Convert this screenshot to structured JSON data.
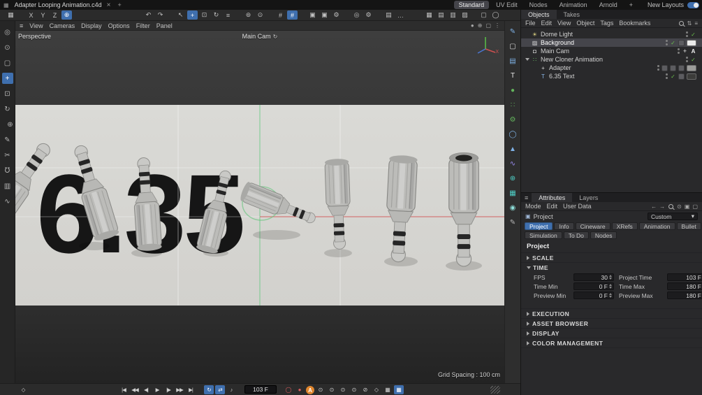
{
  "titlebar": {
    "window_icon": "▦",
    "title": "Adapter Looping Animation.c4d",
    "close_glyph": "×",
    "new_tab_glyph": "+",
    "layout_tabs": [
      {
        "name": "layout-tab-standard",
        "label": "Standard",
        "active": true
      },
      {
        "name": "layout-tab-uvedit",
        "label": "UV Edit"
      },
      {
        "name": "layout-tab-nodes",
        "label": "Nodes"
      },
      {
        "name": "layout-tab-animation",
        "label": "Animation"
      },
      {
        "name": "layout-tab-arnold",
        "label": "Arnold"
      },
      {
        "name": "layout-tab-add",
        "label": "+"
      }
    ],
    "new_layouts_label": "New Layouts"
  },
  "toolbar": {
    "icons": [
      {
        "name": "workplane-icon",
        "glyph": "▦"
      },
      {
        "name": "axis-x-button",
        "glyph": "X",
        "gap": 12
      },
      {
        "name": "axis-y-button",
        "glyph": "Y"
      },
      {
        "name": "axis-z-button",
        "glyph": "Z"
      },
      {
        "name": "coord-system-button",
        "glyph": "⊕",
        "active": true
      },
      {
        "name": "undo-button",
        "glyph": "↶",
        "gap": 100
      },
      {
        "name": "redo-button",
        "glyph": "↷"
      },
      {
        "name": "live-selection-button",
        "glyph": "↖",
        "gap": 12
      },
      {
        "name": "move-tool-button",
        "glyph": "+",
        "active": true
      },
      {
        "name": "scale-tool-button",
        "glyph": "⊡"
      },
      {
        "name": "rotate-tool-button",
        "glyph": "↻"
      },
      {
        "name": "tool-history-button",
        "glyph": "≡"
      },
      {
        "name": "simulate-button",
        "glyph": "⊚",
        "gap": 12
      },
      {
        "name": "pin-button",
        "glyph": "⊙"
      },
      {
        "name": "grid-snap-button",
        "glyph": "#",
        "gap": 12
      },
      {
        "name": "quantize-button",
        "glyph": "#",
        "active": true
      },
      {
        "name": "render-view-button",
        "glyph": "▣",
        "gap": 12
      },
      {
        "name": "render-picture-viewer-button",
        "glyph": "▣"
      },
      {
        "name": "render-settings-button",
        "glyph": "⚙"
      },
      {
        "name": "solo-button",
        "glyph": "◎",
        "gap": 12
      },
      {
        "name": "project-settings-button",
        "glyph": "⚙"
      },
      {
        "name": "content-browser-button",
        "glyph": "▤",
        "gap": 12
      },
      {
        "name": "more-tools-button",
        "glyph": "…"
      }
    ],
    "right_icons": [
      {
        "name": "layout-split-1-button",
        "glyph": "▦"
      },
      {
        "name": "layout-split-2-button",
        "glyph": "▤"
      },
      {
        "name": "layout-split-3-button",
        "glyph": "▥"
      },
      {
        "name": "layout-split-4-button",
        "glyph": "▨"
      },
      {
        "name": "panel-toggle-button",
        "glyph": "▢",
        "gap": 10
      },
      {
        "name": "capsule-button",
        "glyph": "◯"
      }
    ]
  },
  "left_strip": {
    "icons": [
      {
        "name": "zoom-tool-icon",
        "glyph": "◎"
      },
      {
        "name": "selection-tool-icon",
        "glyph": "⊙"
      },
      {
        "name": "lasso-tool-icon",
        "glyph": "▢"
      },
      {
        "name": "move-tool-icon",
        "glyph": "+",
        "active": true
      },
      {
        "name": "scale-tool-icon",
        "glyph": "⊡"
      },
      {
        "name": "rotate-tool-icon",
        "glyph": "↻"
      },
      {
        "name": "axis-lock-icon",
        "glyph": "⊕",
        "gap": 8
      },
      {
        "name": "brush-tool-icon",
        "glyph": "✎"
      },
      {
        "name": "knife-tool-icon",
        "glyph": "✂"
      },
      {
        "name": "magnet-tool-icon",
        "glyph": "℧"
      },
      {
        "name": "mirror-tool-icon",
        "glyph": "▥"
      },
      {
        "name": "smooth-tool-icon",
        "glyph": "∿"
      }
    ]
  },
  "viewport": {
    "menu_icon": "≡",
    "menu": [
      "View",
      "Cameras",
      "Display",
      "Options",
      "Filter",
      "Panel"
    ],
    "corner_icons": [
      {
        "name": "hud-icon",
        "glyph": "●"
      },
      {
        "name": "gizmo-toggle-icon",
        "glyph": "⊕"
      },
      {
        "name": "viewport-layout-icon",
        "glyph": "▢"
      },
      {
        "name": "viewport-options-icon",
        "glyph": "⋮"
      }
    ],
    "view_label": "Perspective",
    "camera_label": "Main Cam",
    "camera_swap_glyph": "↻",
    "big_text": "6.35",
    "axis_x_label": "X",
    "grid_spacing_label": "Grid Spacing : 100 cm"
  },
  "shelf": {
    "icons": [
      {
        "name": "spline-pen-icon",
        "glyph": "✎",
        "color": "#7fb2e6"
      },
      {
        "name": "cube-primitive-icon",
        "glyph": "▢",
        "color": "#d8d8d8"
      },
      {
        "name": "extrude-icon",
        "glyph": "▤",
        "color": "#7fb2e6"
      },
      {
        "name": "text-object-icon",
        "glyph": "T",
        "color": "#e8e8e8"
      },
      {
        "name": "sphere-primitive-icon",
        "glyph": "●",
        "color": "#63b35c"
      },
      {
        "name": "cloner-icon",
        "glyph": "∷",
        "color": "#63b35c"
      },
      {
        "name": "dynamics-icon",
        "glyph": "⚙",
        "color": "#63b35c"
      },
      {
        "name": "field-icon",
        "glyph": "◯",
        "color": "#7fb2e6"
      },
      {
        "name": "volume-icon",
        "glyph": "▲",
        "color": "#7fb2e6"
      },
      {
        "name": "deformer-icon",
        "glyph": "∿",
        "color": "#9a8cf0"
      },
      {
        "name": "environment-icon",
        "glyph": "⊕",
        "color": "#4fd0c7"
      },
      {
        "name": "scene-nodes-icon",
        "glyph": "▦",
        "color": "#4fd0c7"
      },
      {
        "name": "material-icon",
        "glyph": "◉",
        "color": "#8eded9"
      },
      {
        "name": "annotation-icon",
        "glyph": "✎",
        "color": "#b5b5b5"
      }
    ]
  },
  "objects_panel": {
    "tabs": [
      {
        "name": "tab-objects",
        "label": "Objects",
        "active": true
      },
      {
        "name": "tab-takes",
        "label": "Takes"
      }
    ],
    "menu": [
      "File",
      "Edit",
      "View",
      "Object",
      "Tags",
      "Bookmarks"
    ],
    "menu_icons": {
      "sort": "⇅",
      "filter": "≡"
    },
    "check_glyph": "✓",
    "items": [
      {
        "label": "Dome Light",
        "icon": "☀"
      },
      {
        "label": "Background",
        "icon": "▨"
      },
      {
        "label": "Main Cam",
        "icon": "◘",
        "cross_glyph": "+",
        "badge": "A"
      },
      {
        "label": "New Cloner Animation",
        "icon": "∷"
      },
      {
        "label": "Adapter",
        "icon": "+"
      },
      {
        "label": "6.35 Text",
        "icon": "T"
      }
    ]
  },
  "attributes_panel": {
    "panel_menu_icon": "≡",
    "tabs": [
      {
        "name": "tab-attributes",
        "label": "Attributes",
        "active": true
      },
      {
        "name": "tab-layers",
        "label": "Layers"
      }
    ],
    "menu": [
      "Mode",
      "Edit",
      "User Data"
    ],
    "menu_icons": {
      "back": "←",
      "forward": "→",
      "pin": "⊙",
      "lock": "▣",
      "float": "▢"
    },
    "object_icon": "▣",
    "object_name": "Project",
    "preset_value": "Custom",
    "dropdown_glyph": "▾",
    "tab_row1": [
      {
        "name": "attr-tab-project",
        "label": "Project",
        "active": true
      },
      {
        "name": "attr-tab-info",
        "label": "Info"
      },
      {
        "name": "attr-tab-cineware",
        "label": "Cineware"
      },
      {
        "name": "attr-tab-xrefs",
        "label": "XRefs"
      },
      {
        "name": "attr-tab-animation",
        "label": "Animation"
      },
      {
        "name": "attr-tab-bullet",
        "label": "Bullet"
      }
    ],
    "tab_row2": [
      {
        "name": "attr-tab-simulation",
        "label": "Simulation"
      },
      {
        "name": "attr-tab-todo",
        "label": "To Do"
      },
      {
        "name": "attr-tab-nodes",
        "label": "Nodes"
      }
    ],
    "title": "Project",
    "scale_section_label": "SCALE",
    "time_section_label": "TIME",
    "time_fields": [
      {
        "label": "FPS",
        "value": "30"
      },
      {
        "label": "Project Time",
        "value": "103 F"
      },
      {
        "label": "Time Min",
        "value": "0 F"
      },
      {
        "label": "Time Max",
        "value": "180 F"
      },
      {
        "label": "Preview Min",
        "value": "0 F"
      },
      {
        "label": "Preview Max",
        "value": "180 F"
      }
    ],
    "collapsed_sections": [
      "EXECUTION",
      "ASSET BROWSER",
      "DISPLAY",
      "COLOR MANAGEMENT"
    ]
  },
  "bottom_bar": {
    "keyframe_glyph": "◇",
    "transport": [
      {
        "name": "jump-start-button",
        "glyph": "|◀"
      },
      {
        "name": "prev-key-button",
        "glyph": "◀◀"
      },
      {
        "name": "prev-frame-button",
        "glyph": "◀|"
      },
      {
        "name": "play-button",
        "glyph": "▶"
      },
      {
        "name": "next-frame-button",
        "glyph": "|▶"
      },
      {
        "name": "next-key-button",
        "glyph": "▶▶"
      },
      {
        "name": "jump-end-button",
        "glyph": "▶|"
      },
      {
        "name": "loop-mode-button",
        "glyph": "↻",
        "active": true,
        "gap": 10
      },
      {
        "name": "range-mode-button",
        "glyph": "⇄",
        "active": true
      },
      {
        "name": "sound-toggle-button",
        "glyph": "♪"
      }
    ],
    "frame_value": "103 F",
    "record_icons": [
      {
        "name": "record-ring-button",
        "glyph": "◯",
        "color": "#d85c5c"
      },
      {
        "name": "record-dot-button",
        "glyph": "●",
        "color": "#d85c5c"
      },
      {
        "name": "autokey-button",
        "glyph": "A",
        "class": "autokey"
      },
      {
        "name": "record-position-button",
        "glyph": "⊙"
      },
      {
        "name": "record-scale-button",
        "glyph": "⊙"
      },
      {
        "name": "record-rotation-button",
        "glyph": "⊙"
      },
      {
        "name": "record-parameter-button",
        "glyph": "⊙"
      },
      {
        "name": "record-pla-button",
        "glyph": "⊘"
      },
      {
        "name": "keyframe-selection-button",
        "glyph": "◇"
      },
      {
        "name": "keyframe-presets-button",
        "glyph": "▦"
      },
      {
        "name": "snap-keys-button",
        "glyph": "▦",
        "active": true
      }
    ]
  }
}
